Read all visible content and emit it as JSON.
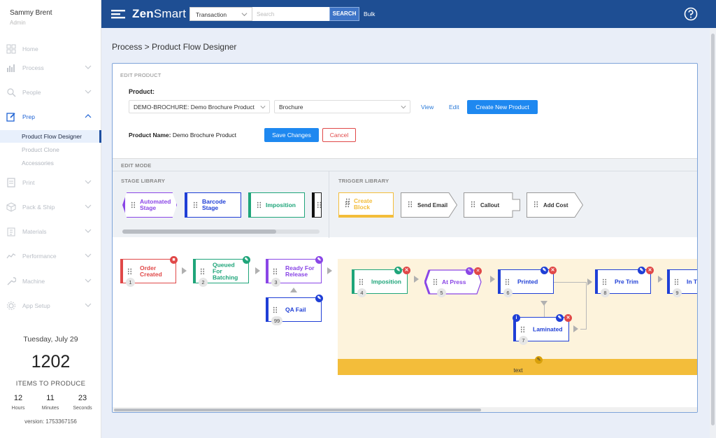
{
  "user": {
    "name": "Sammy Brent",
    "role": "Admin"
  },
  "sidebar": {
    "items": [
      {
        "label": "Home",
        "icon": "grid-icon"
      },
      {
        "label": "Process",
        "icon": "bar-chart-icon"
      },
      {
        "label": "People",
        "icon": "search-people-icon"
      },
      {
        "label": "Prep",
        "icon": "edit-icon"
      },
      {
        "label": "Print",
        "icon": "print-icon"
      },
      {
        "label": "Pack & Ship",
        "icon": "box-icon"
      },
      {
        "label": "Materials",
        "icon": "clipboard-icon"
      },
      {
        "label": "Performance",
        "icon": "trend-icon"
      },
      {
        "label": "Machine",
        "icon": "wrench-icon"
      },
      {
        "label": "App Setup",
        "icon": "gear-icon"
      }
    ],
    "sub_items": [
      "Product Flow Designer",
      "Product Clone",
      "Accessories"
    ]
  },
  "stats": {
    "date": "Tuesday, July 29",
    "count": "1202",
    "count_label": "ITEMS TO PRODUCE",
    "hours": "12",
    "hours_label": "Hours",
    "minutes": "11",
    "minutes_label": "Minutes",
    "seconds": "23",
    "seconds_label": "Seconds",
    "version": "version: 1753367156"
  },
  "topbar": {
    "logo_bold": "Zen",
    "logo_rest": "Smart",
    "search_type": "Transaction",
    "search_placeholder": "Search",
    "search_button": "SEARCH",
    "bulk": "Bulk"
  },
  "breadcrumb": "Process > Product Flow Designer",
  "edit_product": {
    "section": "EDIT PRODUCT",
    "product_label": "Product:",
    "product_value": "DEMO-BROCHURE: Demo Brochure Product",
    "type_value": "Brochure",
    "view": "View",
    "edit": "Edit",
    "create": "Create New Product",
    "name_label": "Product Name:",
    "name_value": "Demo Brochure Product",
    "save": "Save Changes",
    "cancel": "Cancel"
  },
  "edit_mode": {
    "section": "EDIT MODE",
    "stage_library": "STAGE LIBRARY",
    "trigger_library": "TRIGGER LIBRARY",
    "stages": [
      "Automated Stage",
      "Barcode Stage",
      "Imposition"
    ],
    "triggers": [
      "Create Block",
      "Send Email",
      "Callout",
      "Add Cost"
    ]
  },
  "flow": {
    "stages": [
      {
        "name": "Order Created",
        "num": "1"
      },
      {
        "name": "Queued For Batching",
        "num": "2"
      },
      {
        "name": "Ready For Release",
        "num": "3"
      },
      {
        "name": "QA Fail",
        "num": "99"
      },
      {
        "name": "Imposition",
        "num": "4"
      },
      {
        "name": "At Press",
        "num": "5"
      },
      {
        "name": "Printed",
        "num": "6"
      },
      {
        "name": "Laminated",
        "num": "7"
      },
      {
        "name": "Pre Trim",
        "num": "8"
      },
      {
        "name": "In Tr",
        "num": "9"
      }
    ],
    "block_text": "text"
  },
  "colors": {
    "red": "#e04848",
    "green": "#1fa57a",
    "purple": "#8a46e6",
    "blue": "#1f3fd6",
    "orange": "#f3bd3a"
  }
}
